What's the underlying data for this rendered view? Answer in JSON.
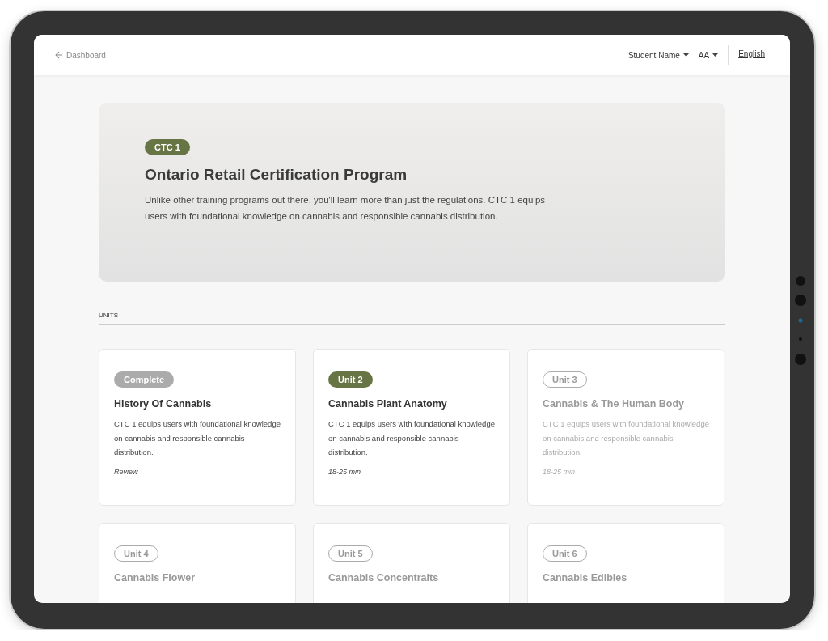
{
  "header": {
    "back_link": "Dashboard",
    "user_menu": "Student Name",
    "text_size": "AA",
    "language": "English"
  },
  "hero": {
    "badge": "CTC 1",
    "title": "Ontario Retail Certification Program",
    "description": "Unlike other training programs out there, you'll learn more than just the regulations. CTC 1 equips users with foundational knowledge on cannabis and responsible cannabis distribution."
  },
  "units_heading": "UNITS",
  "units": [
    {
      "kind": "complete",
      "badge": "Complete",
      "title": "History Of Cannabis",
      "description": "CTC 1 equips users with foundational knowledge on cannabis and responsible cannabis distribution.",
      "footer": "Review"
    },
    {
      "kind": "current",
      "badge": "Unit 2",
      "title": "Cannabis Plant Anatomy",
      "description": "CTC 1 equips users with foundational knowledge on cannabis and responsible cannabis distribution.",
      "footer": "18-25 min"
    },
    {
      "kind": "locked",
      "badge": "Unit 3",
      "title": "Cannabis & The Human Body",
      "description": "CTC 1 equips users with foundational knowledge on cannabis and responsible cannabis distribution.",
      "footer": "18-25 min"
    },
    {
      "kind": "locked",
      "badge": "Unit 4",
      "title": "Cannabis Flower"
    },
    {
      "kind": "locked",
      "badge": "Unit 5",
      "title": "Cannabis Concentraits"
    },
    {
      "kind": "locked",
      "badge": "Unit 6",
      "title": "Cannabis Edibles"
    }
  ]
}
